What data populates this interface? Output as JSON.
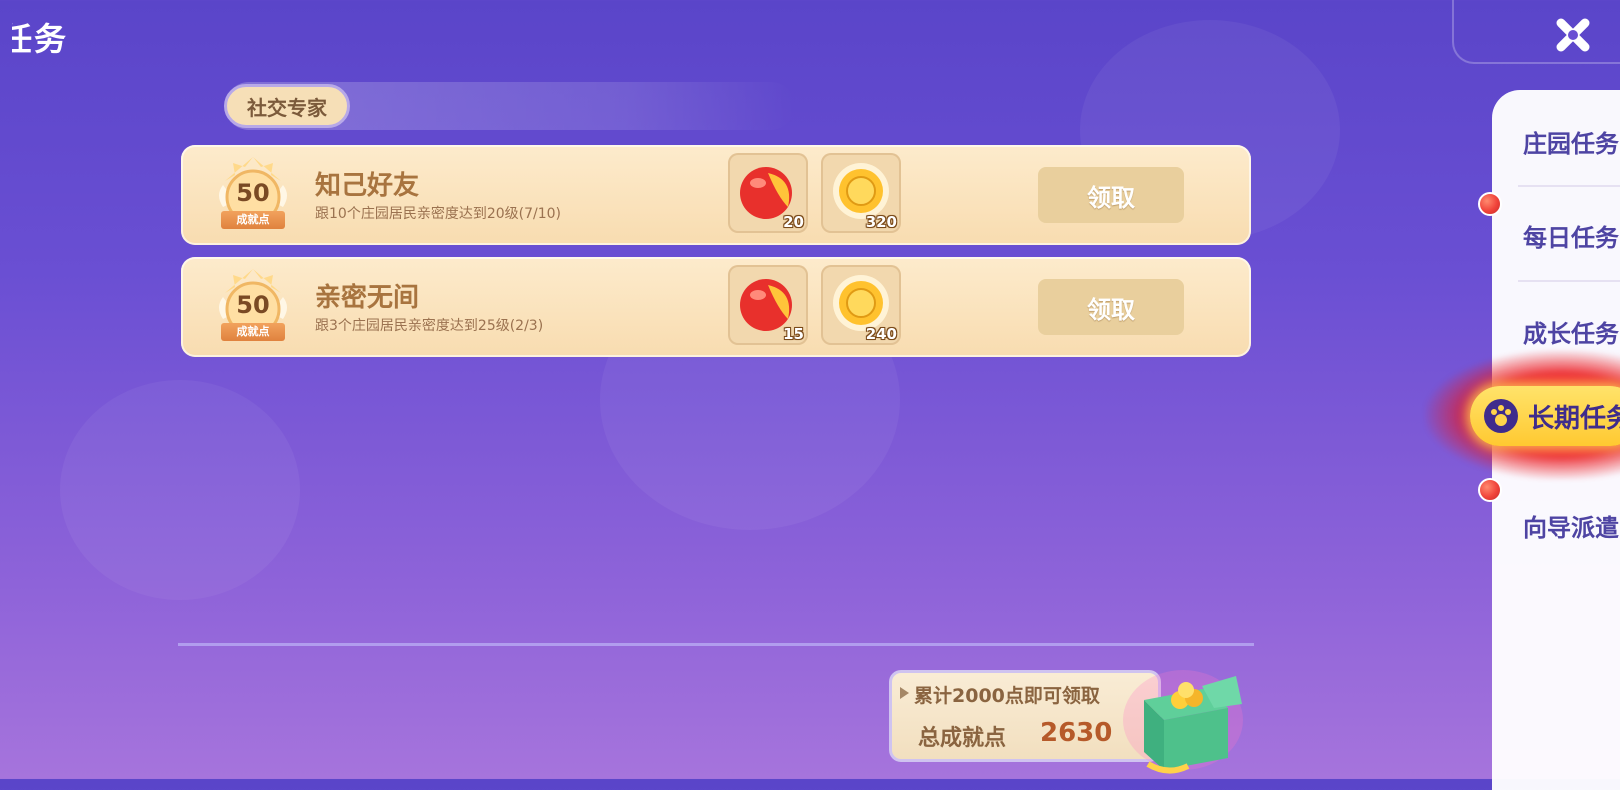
{
  "header": {
    "title": "任务"
  },
  "category": {
    "label": "社交专家"
  },
  "tasks": [
    {
      "points": "50",
      "points_label": "成就点",
      "name": "知己好友",
      "desc": "跟10个庄园居民亲密度达到20级(7/10)",
      "rewards": [
        {
          "icon": "red-ball-icon",
          "count": "20"
        },
        {
          "icon": "gold-coin-icon",
          "count": "320"
        }
      ],
      "button": "领取"
    },
    {
      "points": "50",
      "points_label": "成就点",
      "name": "亲密无间",
      "desc": "跟3个庄园居民亲密度达到25级(2/3)",
      "rewards": [
        {
          "icon": "red-ball-icon",
          "count": "15"
        },
        {
          "icon": "gold-coin-icon",
          "count": "240"
        }
      ],
      "button": "领取"
    }
  ],
  "sidebar": {
    "items": [
      {
        "label": "庄园任务"
      },
      {
        "label": "每日任务"
      },
      {
        "label": "成长任务"
      },
      {
        "label": "长期任务"
      },
      {
        "label": "向导派遣"
      }
    ],
    "active_index": 3
  },
  "summary": {
    "hint": "累计2000点即可领取",
    "total_label": "总成就点",
    "total_value": "2630"
  },
  "colors": {
    "accent": "#ffc931",
    "card": "#fdebcc",
    "alert": "#f0433a"
  }
}
